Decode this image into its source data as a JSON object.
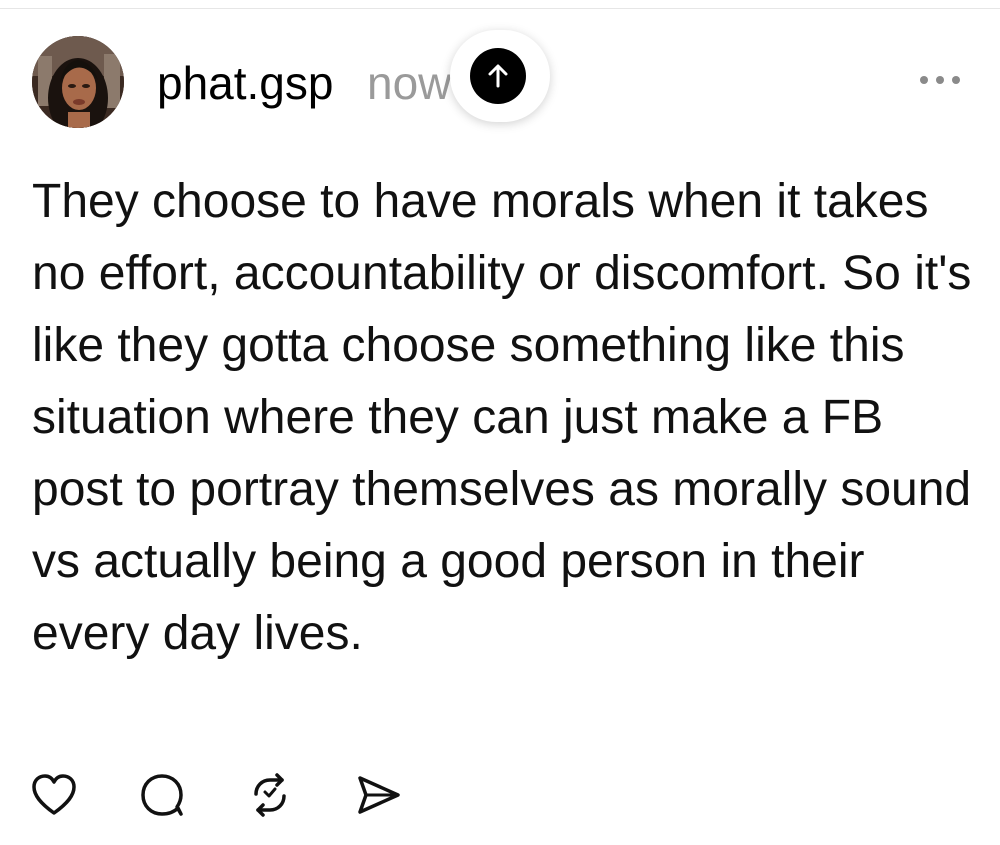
{
  "post": {
    "username": "phat.gsp",
    "timestamp": "now",
    "body": "They choose to have morals when it takes no effort, accountability or discomfort. So it's like they gotta choose something like this situation where they can just make a FB post to portray themselves as morally sound vs actually being a good person in their every day lives."
  },
  "icons": {
    "scroll_top": "arrow-up-icon",
    "more": "more-horizontal-icon",
    "like": "heart-icon",
    "reply": "comment-icon",
    "repost": "repost-icon",
    "share": "send-icon"
  },
  "colors": {
    "text": "#111111",
    "muted": "#9a9a9a",
    "accent": "#000000",
    "background": "#ffffff"
  }
}
